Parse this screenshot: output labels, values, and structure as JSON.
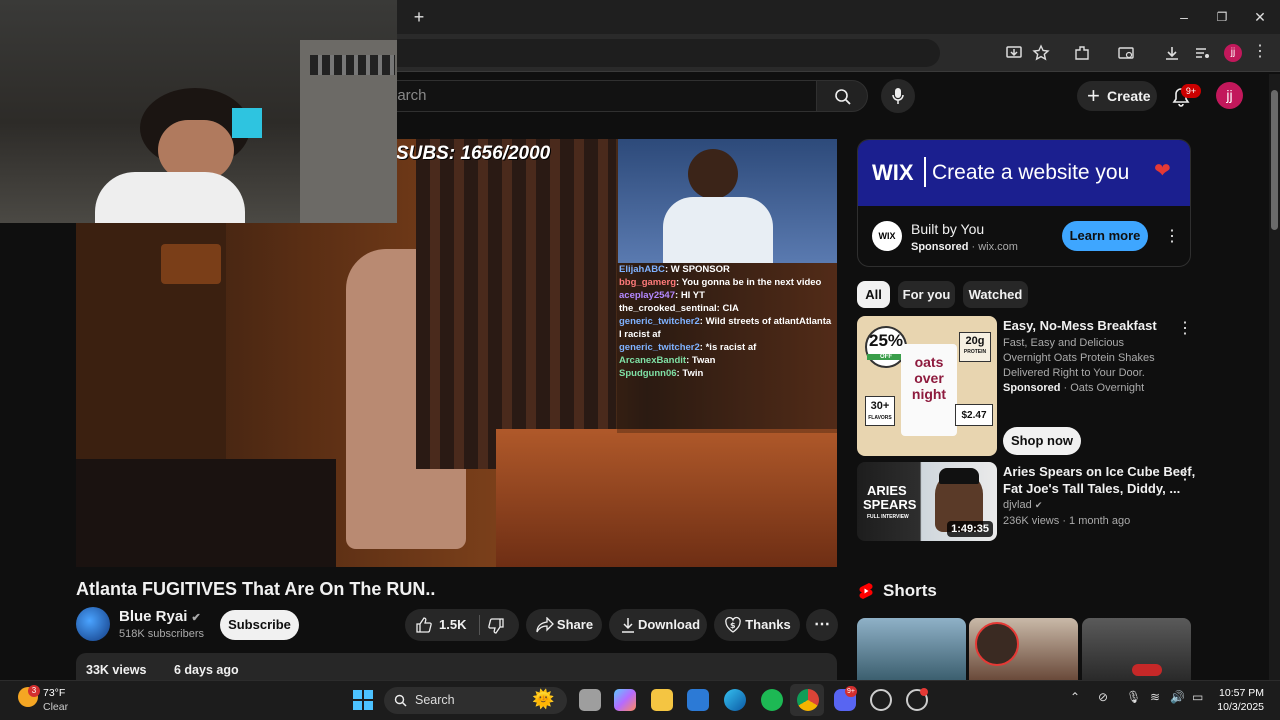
{
  "browser": {
    "new_tab_glyph": "+",
    "window_controls": [
      "–",
      "❐",
      "✕"
    ],
    "profile_initial": "jj"
  },
  "header": {
    "search_placeholder": "earch",
    "create_label": "Create",
    "notification_badge": "9+",
    "avatar_initial": "jj"
  },
  "video": {
    "overlay_subs": "SUBS: 1656/2000",
    "chat": [
      {
        "user": "ElijahABC",
        "text": "W SPONSOR",
        "color": "#7fb2ff"
      },
      {
        "user": "bbg_gamerg",
        "text": "You gonna be in the next video",
        "color": "#ff7a7a"
      },
      {
        "user": "aceplay2547",
        "text": "HI YT",
        "color": "#b388ff"
      },
      {
        "user": "the_crooked_sentinal",
        "text": "CIA",
        "color": "#ffffff"
      },
      {
        "user": "generic_twitcher2",
        "text": "Wild streets of atlantAtlanta I racist af",
        "color": "#7fb2ff"
      },
      {
        "user": "generic_twitcher2",
        "text": "*is racist af",
        "color": "#7fb2ff"
      },
      {
        "user": "ArcanexBandit",
        "text": "Twan",
        "color": "#7fe0a5"
      },
      {
        "user": "Spudgunn06",
        "text": "Twin",
        "color": "#7fe0a5"
      }
    ],
    "title": "Atlanta FUGITIVES That Are On The RUN..",
    "channel": "Blue Ryai",
    "subscribers": "518K subscribers",
    "subscribe_label": "Subscribe",
    "likes": "1.5K",
    "share_label": "Share",
    "download_label": "Download",
    "thanks_label": "Thanks",
    "views": "33K views",
    "age": "6 days ago"
  },
  "ad": {
    "banner_brand": "WIX",
    "banner_text": "Create a website you",
    "logo_text": "WIX",
    "title": "Built by You",
    "sponsored": "Sponsored",
    "domain": "wix.com",
    "cta": "Learn more"
  },
  "chips": [
    "All",
    "For you",
    "Watched"
  ],
  "recommendations": [
    {
      "title": "Easy, No-Mess Breakfast",
      "desc": "Fast, Easy and Delicious Overnight Oats Protein Shakes Delivered Right to Your Door.",
      "sponsored": "Sponsored",
      "advertiser": "Oats Overnight",
      "cta": "Shop now",
      "thumb_badge": "25%",
      "thumb_badge_sub": "OFF",
      "thumb_protein": "20g",
      "thumb_protein_sub": "PROTEIN",
      "thumb_brand_line1": "oats",
      "thumb_brand_line2": "over",
      "thumb_brand_line3": "night",
      "thumb_flavors": "30+",
      "thumb_flavors_sub": "FLAVORS",
      "thumb_price": "$2.47"
    },
    {
      "title_line1": "Aries Spears on Ice Cube Beef,",
      "title_line2": "Fat Joe's Tall Tales, Diddy, ...",
      "channel": "djvlad",
      "views": "236K views",
      "age": "1 month ago",
      "duration": "1:49:35",
      "thumb_text1": "ARIES",
      "thumb_text2": "SPEARS",
      "thumb_text3": "FULL INTERVIEW"
    }
  ],
  "shorts": {
    "title": "Shorts"
  },
  "taskbar": {
    "weather_temp": "73°F",
    "weather_cond": "Clear",
    "weather_badge": "3",
    "search_label": "Search",
    "discord_badge": "9+",
    "time": "10:57 PM",
    "date": "10/3/2025"
  },
  "colors": {
    "accent_red": "#ff0000",
    "badge_red": "#cc0000",
    "link_blue": "#3ea6ff",
    "wix_banner": "#1b1f8f"
  }
}
